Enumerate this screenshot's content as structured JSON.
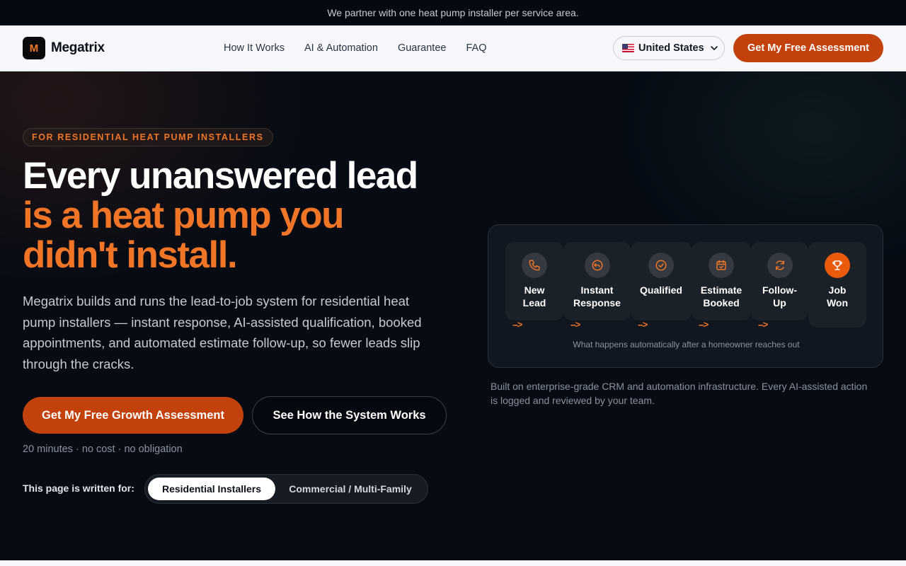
{
  "announcement": "We partner with one heat pump installer per service area.",
  "brand": {
    "mark": "M",
    "name": "Megatrix"
  },
  "nav": {
    "links": [
      "How It Works",
      "AI & Automation",
      "Guarantee",
      "FAQ"
    ],
    "country": "United States",
    "cta": "Get My Free Assessment"
  },
  "hero": {
    "eyebrow": "FOR RESIDENTIAL HEAT PUMP INSTALLERS",
    "headline_white": "Every unanswered lead ",
    "headline_accent": "is a heat pump you didn't install.",
    "lead": "Megatrix builds and runs the lead-to-job system for residential heat pump installers — instant response, AI-assisted qualification, booked appointments, and automated estimate follow-up, so fewer leads slip through the cracks.",
    "primary_cta": "Get My Free Growth Assessment",
    "secondary_cta": "See How the System Works",
    "fine_print": "20 minutes · no cost · no obligation",
    "audience_label": "This page is written for:",
    "audience_options": [
      "Residential Installers",
      "Commercial / Multi-Family"
    ],
    "audience_selected": "Residential Installers"
  },
  "flow": {
    "steps": [
      {
        "label": "New Lead",
        "icon": "phone-icon"
      },
      {
        "label": "Instant Response",
        "icon": "reply-icon"
      },
      {
        "label": "Qualified",
        "icon": "check-circle-icon"
      },
      {
        "label": "Estimate Booked",
        "icon": "calendar-check-icon"
      },
      {
        "label": "Follow-Up",
        "icon": "refresh-icon"
      },
      {
        "label": "Job Won",
        "icon": "trophy-icon"
      }
    ],
    "arrow": "-->",
    "caption": "What happens automatically after a homeowner reaches out"
  },
  "trust_note": "Built on enterprise-grade CRM and automation infrastructure. Every AI-assisted action is logged and reviewed by your team.",
  "colors": {
    "accent": "#f07526",
    "cta": "#c2410c",
    "background": "#060b14"
  }
}
